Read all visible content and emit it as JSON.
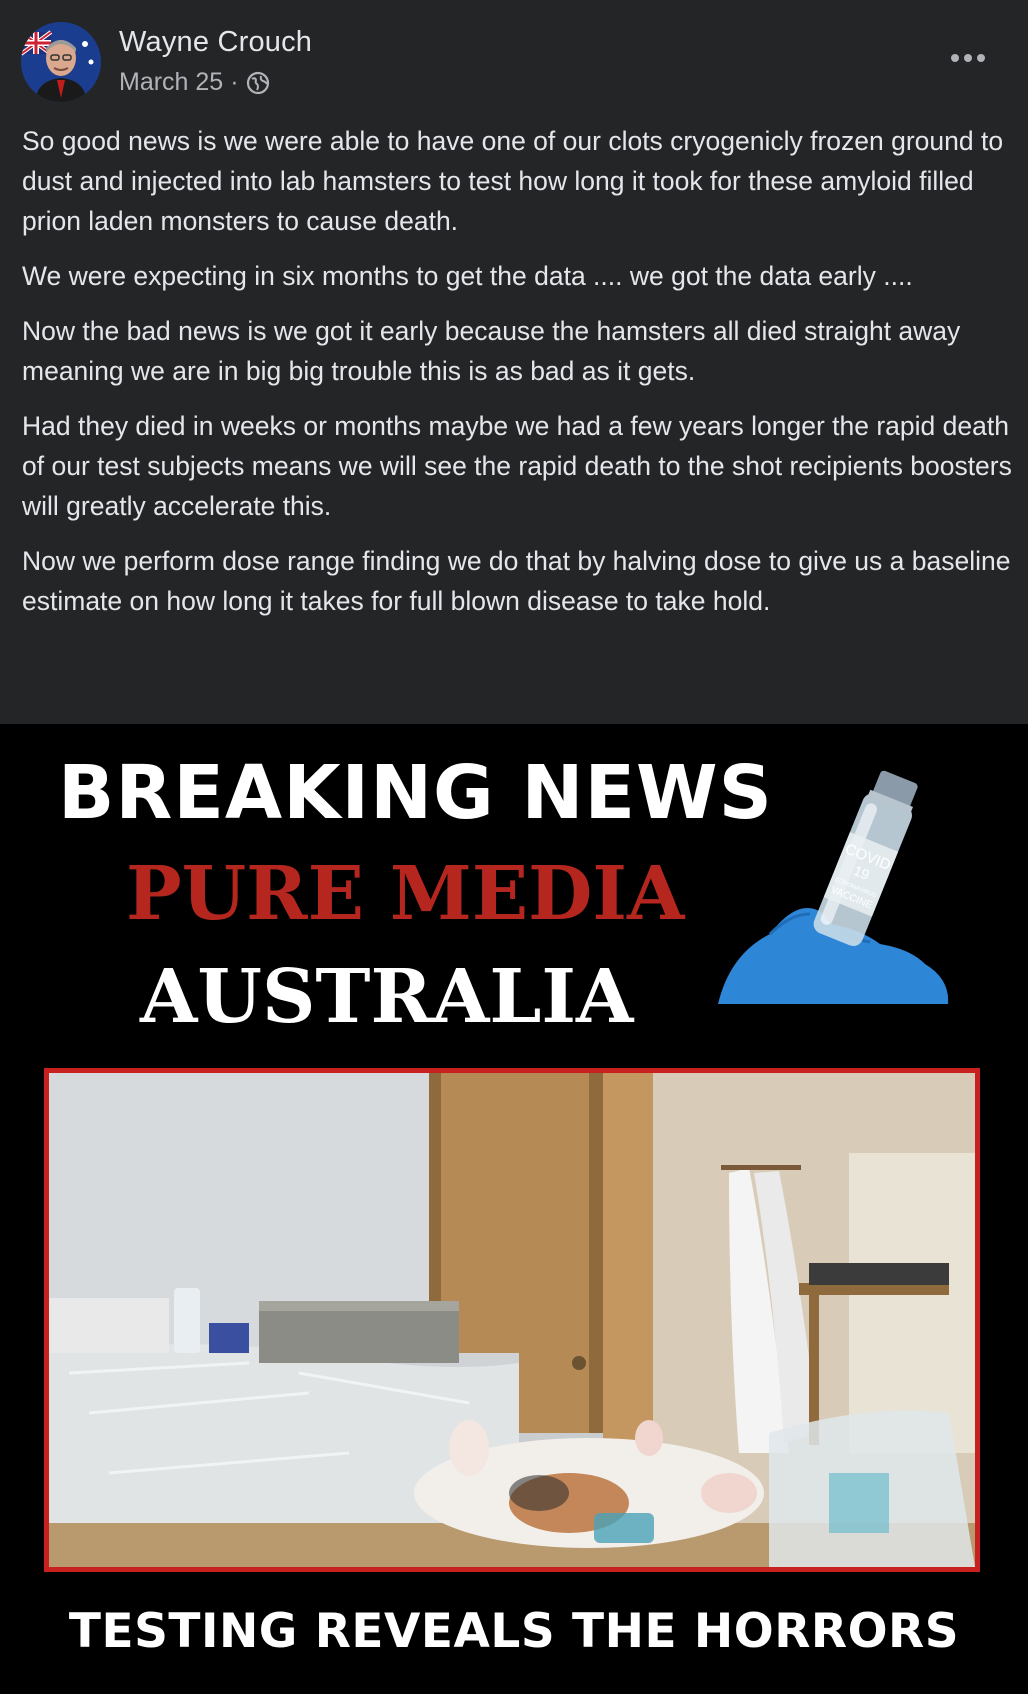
{
  "post": {
    "author": "Wayne Crouch",
    "date": "March 25",
    "separator": "·",
    "privacy_icon": "globe-icon",
    "more_icon": "more-options-icon",
    "paragraphs": [
      "So good news is we were able to have one of our clots cryogenicly frozen ground to dust and injected into lab hamsters to test how long it took for these amyloid filled prion laden monsters to cause death.",
      "We were expecting in six months to get the data .... we got the data early ....",
      "Now the bad news is we got it early because the hamsters all died straight away meaning we are in big big trouble this is as bad as it gets.",
      "Had they died in weeks or months maybe we had a few years longer the rapid death of our test subjects means we will see the rapid death to the shot recipients boosters will greatly accelerate this.",
      "Now we perform dose range finding we do that by halving dose to give us a baseline estimate on how long it takes for full blown disease to take hold."
    ]
  },
  "image": {
    "headline_1": "BREAKING NEWS",
    "headline_2": "PURE MEDIA",
    "headline_3": "AUSTRALIA",
    "vial_label_1": "COVID",
    "vial_label_2": "19",
    "vial_label_3": "CORONAVIRUS",
    "vial_label_4": "VACCINE",
    "caption": "TESTING REVEALS THE HORRORS"
  },
  "colors": {
    "background": "#242526",
    "text_primary": "#e4e6eb",
    "text_secondary": "#b0b3b8",
    "headline_red": "#b5261e",
    "frame_red": "#c8201e"
  }
}
